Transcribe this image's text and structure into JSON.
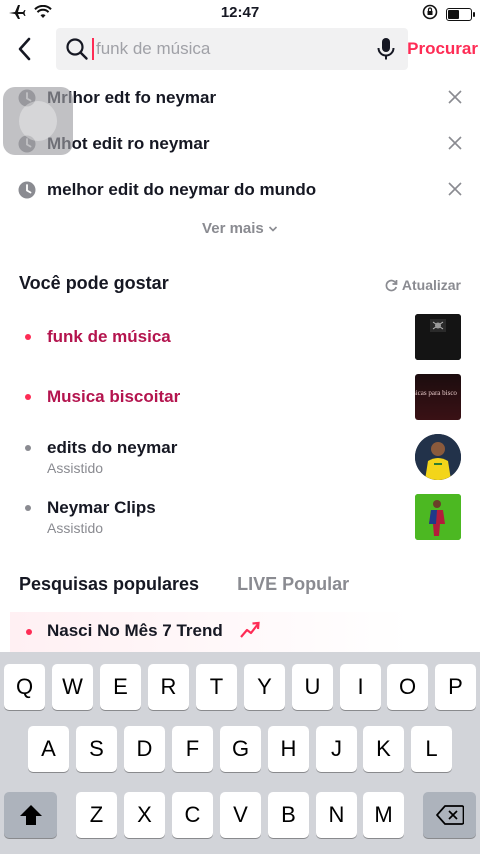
{
  "status_bar": {
    "time": "12:47",
    "icons": [
      "airplane-icon",
      "wifi-icon",
      "rotation-lock-icon",
      "battery-icon"
    ]
  },
  "search": {
    "placeholder": "funk de música",
    "value": "",
    "submit_label": "Procurar"
  },
  "history": {
    "items": [
      {
        "text": "Mrlhor edt fo neymar"
      },
      {
        "text": "Mhot edit ro neymar"
      },
      {
        "text": "melhor edit do neymar do mundo"
      }
    ],
    "see_more_label": "Ver mais"
  },
  "suggestions": {
    "title": "Você pode gostar",
    "refresh_label": "Atualizar",
    "items": [
      {
        "label": "funk de música",
        "sub": "",
        "highlight": true,
        "thumb": "thumb-dark"
      },
      {
        "label": "Musica biscoitar",
        "sub": "",
        "highlight": true,
        "thumb": "thumb-dark-red",
        "thumb_text": "sicas para bisco"
      },
      {
        "label": "edits do neymar",
        "sub": "Assistido",
        "highlight": false,
        "thumb": "thumb-avatar"
      },
      {
        "label": "Neymar Clips",
        "sub": "Assistido",
        "highlight": false,
        "thumb": "thumb-green"
      }
    ]
  },
  "popular": {
    "tabs": [
      {
        "label": "Pesquisas populares",
        "active": true
      },
      {
        "label": "LIVE Popular",
        "active": false
      }
    ],
    "top_item": "Nasci No Mês 7 Trend"
  },
  "keyboard": {
    "row1": [
      "Q",
      "W",
      "E",
      "R",
      "T",
      "Y",
      "U",
      "I",
      "O",
      "P"
    ],
    "row2": [
      "A",
      "S",
      "D",
      "F",
      "G",
      "H",
      "J",
      "K",
      "L"
    ],
    "row3": [
      "Z",
      "X",
      "C",
      "V",
      "B",
      "N",
      "M"
    ]
  },
  "colors": {
    "accent": "#fe2c55",
    "highlight_text": "#b4144e",
    "muted": "#8a8b91"
  }
}
